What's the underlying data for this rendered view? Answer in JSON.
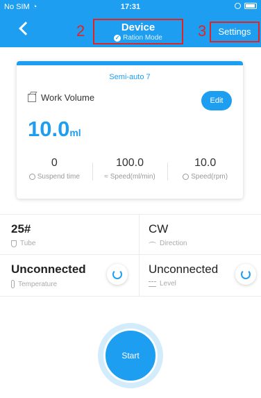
{
  "status_bar": {
    "carrier": "No SIM",
    "time": "17:31"
  },
  "header": {
    "title": "Device",
    "subtitle": "Ration Mode",
    "settings_label": "Settings",
    "annotation_title": "2",
    "annotation_settings": "3"
  },
  "card": {
    "mode": "Semi-auto 7",
    "work_volume_label": "Work Volume",
    "edit_label": "Edit",
    "volume_value": "10.0",
    "volume_unit": "ml",
    "stats": [
      {
        "value": "0",
        "label": "Suspend time",
        "icon": "clock-icon"
      },
      {
        "value": "100.0",
        "label": "Speed(ml/min)",
        "icon": "flow-icon"
      },
      {
        "value": "10.0",
        "label": "Speed(rpm)",
        "icon": "rotation-icon"
      }
    ]
  },
  "info": {
    "tube_value": "25#",
    "tube_label": "Tube",
    "direction_value": "CW",
    "direction_label": "Direction",
    "temperature_value": "Unconnected",
    "temperature_label": "Temperature",
    "level_value": "Unconnected",
    "level_label": "Level"
  },
  "start_label": "Start",
  "colors": {
    "accent": "#1e9ef0",
    "annotation": "#e02424"
  }
}
